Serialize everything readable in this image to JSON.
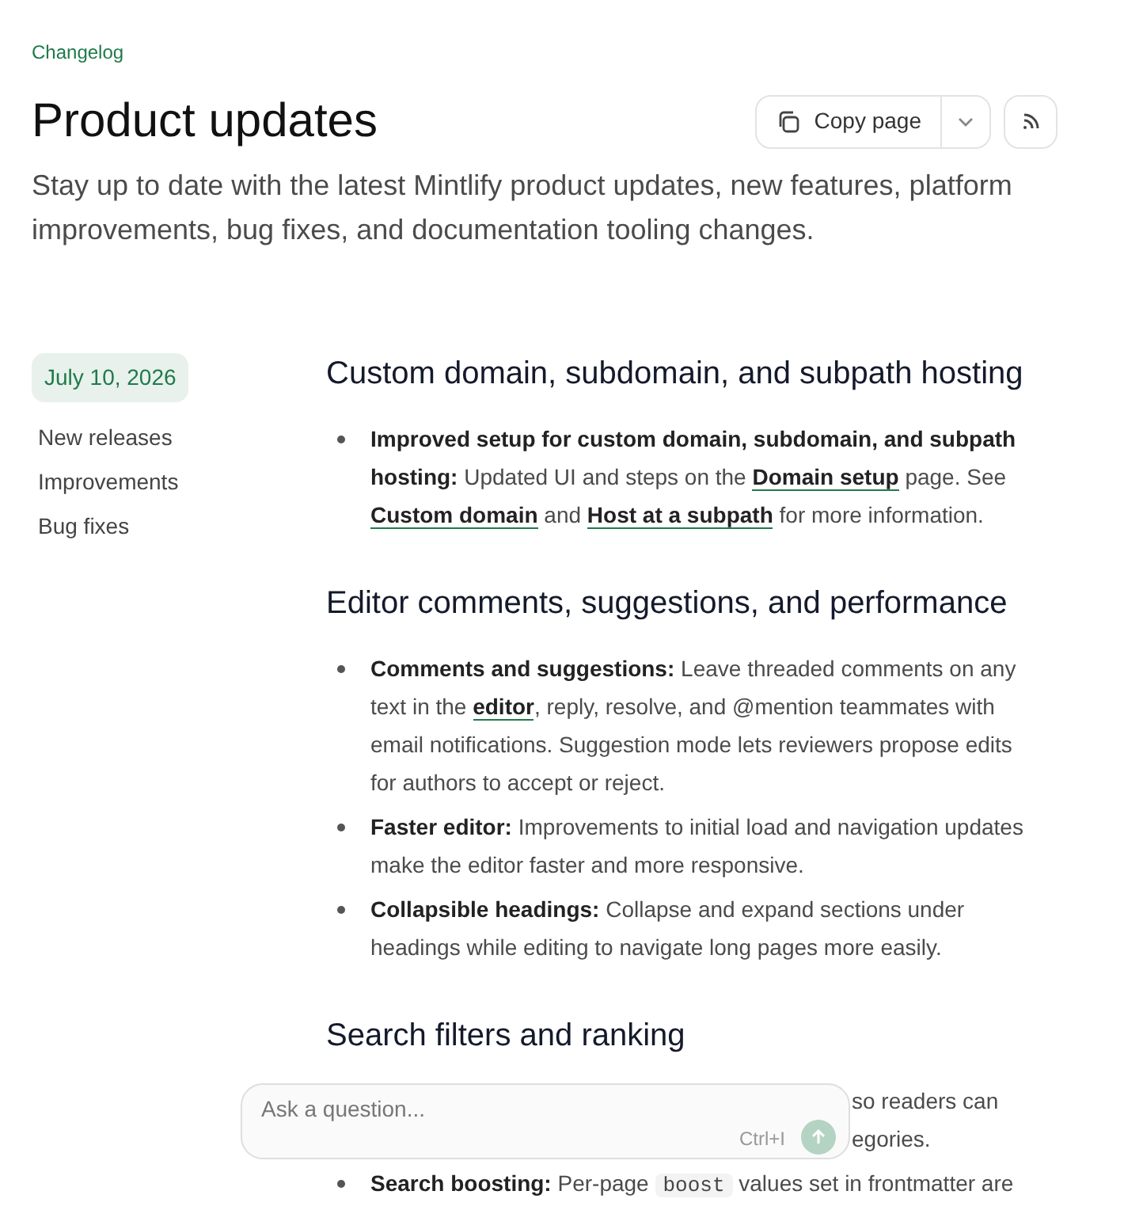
{
  "breadcrumb": "Changelog",
  "title": "Product updates",
  "copy_button": "Copy page",
  "description": "Stay up to date with the latest Mintlify product updates, new features, platform improvements, bug fixes, and documentation tooling changes.",
  "entry": {
    "date": "July 10, 2026",
    "tags": [
      "New releases",
      "Improvements",
      "Bug fixes"
    ],
    "sections": [
      {
        "heading": "Custom domain, subdomain, and subpath hosting",
        "items": [
          {
            "kind": "full",
            "runs": [
              {
                "kind": "bold",
                "text": "Improved setup for custom domain, subdomain, and subpath hosting:"
              },
              {
                "kind": "text",
                "text": " Updated UI and steps on the "
              },
              {
                "kind": "link",
                "text": "Domain setup"
              },
              {
                "kind": "text",
                "text": " page. See "
              },
              {
                "kind": "link",
                "text": "Custom domain"
              },
              {
                "kind": "text",
                "text": " and "
              },
              {
                "kind": "link",
                "text": "Host at a subpath"
              },
              {
                "kind": "text",
                "text": " for more information."
              }
            ]
          }
        ]
      },
      {
        "heading": "Editor comments, suggestions, and performance",
        "items": [
          {
            "kind": "full",
            "runs": [
              {
                "kind": "bold",
                "text": "Comments and suggestions:"
              },
              {
                "kind": "text",
                "text": " Leave threaded comments on any text in the "
              },
              {
                "kind": "link",
                "text": "editor"
              },
              {
                "kind": "text",
                "text": ", reply, resolve, and @mention teammates with email notifications. Suggestion mode lets reviewers propose edits for authors to accept or reject."
              }
            ]
          },
          {
            "kind": "full",
            "runs": [
              {
                "kind": "bold",
                "text": "Faster editor:"
              },
              {
                "kind": "text",
                "text": " Improvements to initial load and navigation updates make the editor faster and more responsive."
              }
            ]
          },
          {
            "kind": "full",
            "runs": [
              {
                "kind": "bold",
                "text": "Collapsible headings:"
              },
              {
                "kind": "text",
                "text": " Collapse and expand sections under headings while editing to navigate long pages more easily."
              }
            ]
          }
        ]
      },
      {
        "heading": "Search filters and ranking",
        "items": [
          {
            "kind": "fragment",
            "lines": [
              "so readers can",
              "egories."
            ]
          },
          {
            "kind": "full",
            "runs": [
              {
                "kind": "bold",
                "text": "Search boosting:"
              },
              {
                "kind": "text",
                "text": " Per-page "
              },
              {
                "kind": "code",
                "text": "boost"
              },
              {
                "kind": "text",
                "text": " values set in frontmatter are"
              }
            ]
          }
        ]
      }
    ]
  },
  "ask": {
    "placeholder": "Ask a question...",
    "shortcut": "Ctrl+I"
  }
}
